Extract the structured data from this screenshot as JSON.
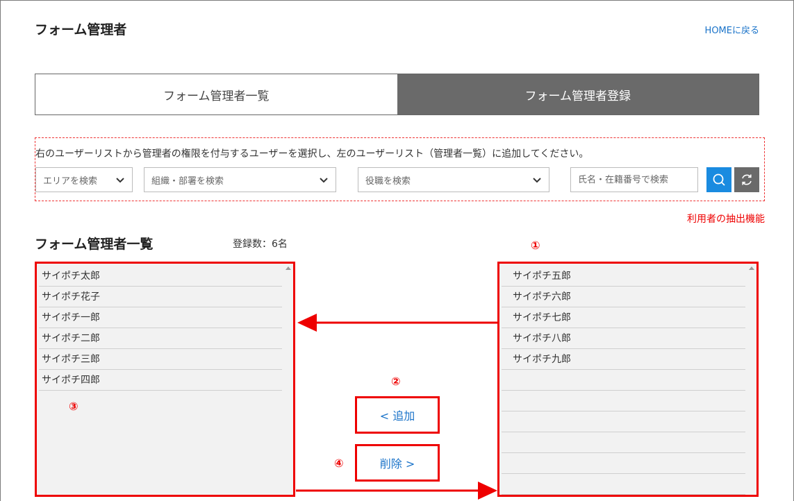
{
  "header": {
    "title": "フォーム管理者",
    "home_link": "HOMEに戻る"
  },
  "tabs": [
    {
      "label": "フォーム管理者一覧",
      "active": false
    },
    {
      "label": "フォーム管理者登録",
      "active": true
    }
  ],
  "filter": {
    "instruction": "右のユーザーリストから管理者の権限を付与するユーザーを選択し、左のユーザーリスト（管理者一覧）に追加してください。",
    "area_select": "エリアを検索",
    "org_select": "組織・部署を検索",
    "title_select": "役職を検索",
    "name_placeholder": "氏名・在籍番号で検索",
    "search_icon": "search-icon",
    "reset_icon": "refresh-icon"
  },
  "annotations": {
    "extraction_note": "利用者の抽出機能",
    "marker_1": "①",
    "marker_2": "②",
    "marker_3": "③",
    "marker_4": "④"
  },
  "admin_list": {
    "title": "フォーム管理者一覧",
    "count_label": "登録数：6名",
    "items": [
      "サイポチ太郎",
      "サイポチ花子",
      "サイポチ一郎",
      "サイポチ二郎",
      "サイポチ三郎",
      "サイポチ四郎"
    ]
  },
  "user_list": {
    "items": [
      "サイポチ五郎",
      "サイポチ六郎",
      "サイポチ七郎",
      "サイポチ八郎",
      "サイポチ九郎"
    ]
  },
  "actions": {
    "add_label": "< 追加",
    "remove_label": "削除 >"
  },
  "colors": {
    "annotation_red": "#ee0000",
    "link_blue": "#1a73c9",
    "search_button": "#1a8be0",
    "active_tab": "#6a6a6a"
  }
}
